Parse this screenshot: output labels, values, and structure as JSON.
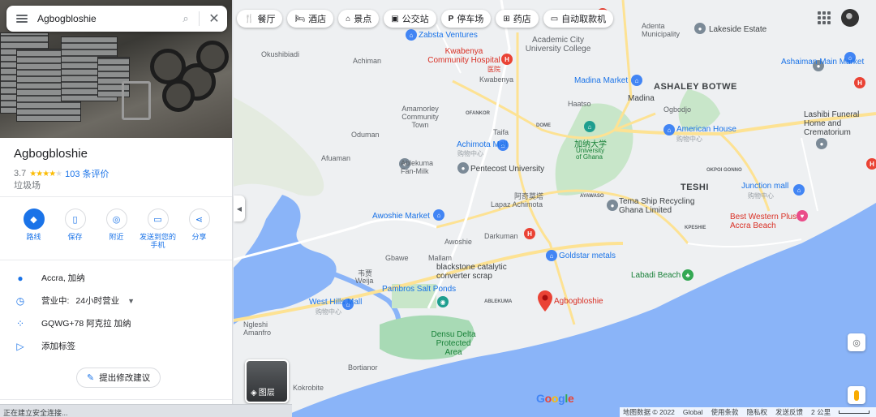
{
  "search": {
    "value": "Agbogbloshie"
  },
  "place": {
    "name": "Agbogbloshie",
    "rating": "3.7",
    "reviews": "103 条评价",
    "category": "垃圾场",
    "address": "Accra, 加纳",
    "hours_status": "营业中:",
    "hours_value": "24小时营业",
    "plus_code": "GQWG+78 阿克拉 加纳",
    "add_label": "添加标签",
    "suggest_edit": "提出修改建议"
  },
  "actions": [
    {
      "label": "路线",
      "icon": "directions-icon"
    },
    {
      "label": "保存",
      "icon": "bookmark-icon"
    },
    {
      "label": "附近",
      "icon": "nearby-icon"
    },
    {
      "label": "发送到您的手机",
      "icon": "send-to-phone-icon"
    },
    {
      "label": "分享",
      "icon": "share-icon"
    }
  ],
  "chips": [
    {
      "label": "餐厅",
      "icon": "restaurant-icon"
    },
    {
      "label": "酒店",
      "icon": "hotel-icon"
    },
    {
      "label": "景点",
      "icon": "attraction-icon"
    },
    {
      "label": "公交站",
      "icon": "bus-icon"
    },
    {
      "label": "停车场",
      "icon": "parking-icon"
    },
    {
      "label": "药店",
      "icon": "pharmacy-icon"
    },
    {
      "label": "自动取款机",
      "icon": "atm-icon"
    }
  ],
  "map": {
    "layers_label": "图层",
    "google": [
      "G",
      "o",
      "o",
      "g",
      "l",
      "e"
    ],
    "footer": {
      "data": "地图数据 © 2022",
      "global": "Global",
      "terms": "使用条款",
      "privacy": "隐私权",
      "feedback": "发送反馈",
      "scale": "2 公里"
    },
    "labels": {
      "ashaley": "ASHALEY BOTWE",
      "teshi": "TESHI",
      "madina": "Madina",
      "haatso": "Haatso",
      "adenta": "Adenta Municipality",
      "lakeside": "Lakeside Estate",
      "ashaiman": "Ashaiman Main Market",
      "lashibi": "Lashibi Funeral Home and Crematorium",
      "zabsta": "Zabsta Ventures",
      "academic": "Academic City University College",
      "kwabenya": "Kwabenya Community Hospital",
      "kwabenya_cn": "医院",
      "kwabenya2": "Kwabenya",
      "madina_market": "Madina Market",
      "ogbodjo": "Ogbodjo",
      "american": "American House",
      "american_cn": "购物中心",
      "okushibiadi": "Okushibiadi",
      "achiman": "Achiman",
      "amamorley": "Amamorley Community Town",
      "oduman": "Oduman",
      "taifa": "Taifa",
      "achimota_mall": "Achimota Mall",
      "achimota_mall_cn": "购物中心",
      "ghana_uni_cn": "加纳大学",
      "ghana_uni": "University of Ghana",
      "afuaman": "Afuaman",
      "ablekuma": "Ablekuma Fan-Milk",
      "pentecost": "Pentecost University",
      "junction": "Junction mall",
      "junction_cn": "购物中心",
      "achimota_cn": "阿奇莫塔",
      "lapaz": "Lapaz Achimota",
      "tema": "Tema Ship Recycling Ghana Limited",
      "bestwestern": "Best Western Plus Accra Beach",
      "awoshie_market": "Awoshie Market",
      "awoshie": "Awoshie",
      "darkuman": "Darkuman",
      "goldstar": "Goldstar metals",
      "labadi": "Labadi Beach",
      "gbawe": "Gbawe",
      "mallam": "Mallam",
      "blackstone": "blackstone catalytic converter scrap",
      "weija_cn": "韦贾",
      "weija": "Weija",
      "pambros": "Pambros Salt Ponds",
      "westhills": "West Hills Mall",
      "westhills_cn": "购物中心",
      "ngleshi": "Ngleshi Amanfro",
      "densu": "Densu Delta Protected Area",
      "bortianor": "Bortianor",
      "kokrobite": "Kokrobite",
      "agbog": "Agbogbloshie",
      "dome": "DOME",
      "ofankor": "OFANKOR",
      "ayawaso": "AYAWASO",
      "ablekuma2": "ABLEKUMA",
      "kpeshie": "KPESHIE",
      "okpoi": "OKPOI GONNO"
    }
  },
  "status_bar": "正在建立安全连接..."
}
